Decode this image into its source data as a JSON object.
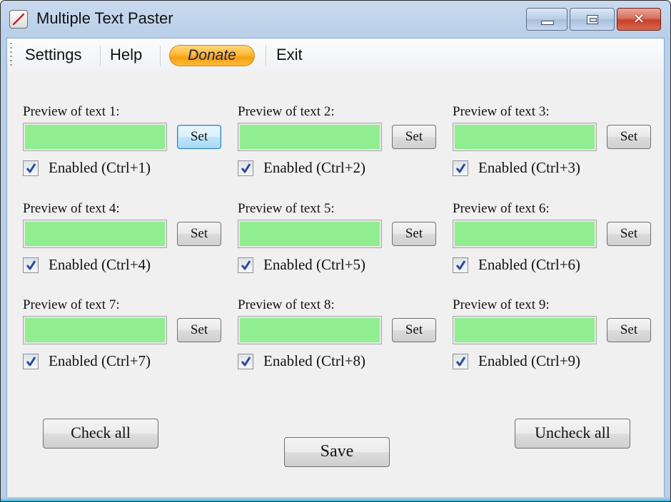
{
  "window": {
    "title": "Multiple Text Paster",
    "icon": "pencil-app-icon",
    "controls": {
      "minimize": "minimize-icon",
      "maximize": "maximize-icon",
      "close": "close-icon",
      "close_glyph": "✕"
    }
  },
  "menu": {
    "items": [
      "Settings",
      "Help",
      "Exit"
    ],
    "donate_label": "Donate"
  },
  "slots": [
    {
      "label": "Preview of text 1:",
      "preview": "",
      "set_label": "Set",
      "enabled": true,
      "enabled_label": "Enabled (Ctrl+1)"
    },
    {
      "label": "Preview of text 2:",
      "preview": "",
      "set_label": "Set",
      "enabled": true,
      "enabled_label": "Enabled (Ctrl+2)"
    },
    {
      "label": "Preview of text 3:",
      "preview": "",
      "set_label": "Set",
      "enabled": true,
      "enabled_label": "Enabled (Ctrl+3)"
    },
    {
      "label": "Preview of text 4:",
      "preview": "",
      "set_label": "Set",
      "enabled": true,
      "enabled_label": "Enabled (Ctrl+4)"
    },
    {
      "label": "Preview of text 5:",
      "preview": "",
      "set_label": "Set",
      "enabled": true,
      "enabled_label": "Enabled (Ctrl+5)"
    },
    {
      "label": "Preview of text 6:",
      "preview": "",
      "set_label": "Set",
      "enabled": true,
      "enabled_label": "Enabled (Ctrl+6)"
    },
    {
      "label": "Preview of text 7:",
      "preview": "",
      "set_label": "Set",
      "enabled": true,
      "enabled_label": "Enabled (Ctrl+7)"
    },
    {
      "label": "Preview of text 8:",
      "preview": "",
      "set_label": "Set",
      "enabled": true,
      "enabled_label": "Enabled (Ctrl+8)"
    },
    {
      "label": "Preview of text 9:",
      "preview": "",
      "set_label": "Set",
      "enabled": true,
      "enabled_label": "Enabled (Ctrl+9)"
    }
  ],
  "actions": {
    "check_all": "Check all",
    "uncheck_all": "Uncheck all",
    "save": "Save"
  },
  "colors": {
    "preview_bg": "#90ee90",
    "donate": "#ffb938",
    "close_button": "#c9402a"
  }
}
